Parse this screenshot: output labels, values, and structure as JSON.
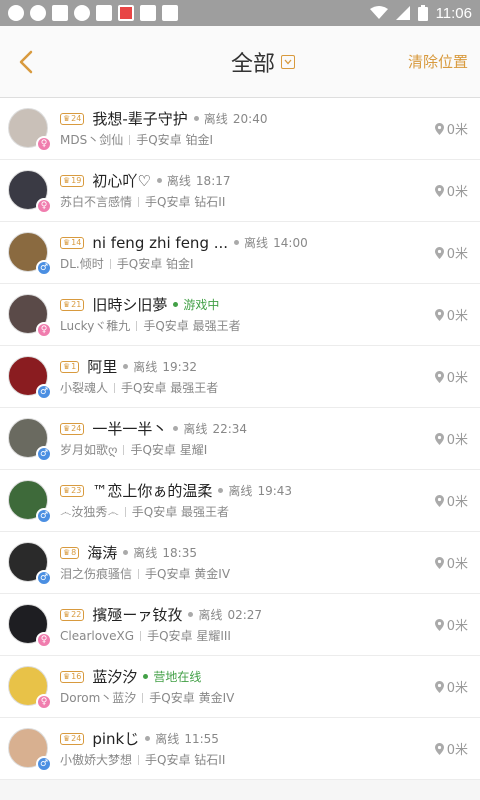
{
  "status_bar": {
    "time": "11:06"
  },
  "header": {
    "title": "全部",
    "clear_label": "清除位置"
  },
  "users": [
    {
      "level": "24",
      "name": "我想-辈子守护",
      "status": "离线",
      "time": "20:40",
      "online": false,
      "nick": "MDS丶剑仙",
      "platform": "手Q安卓",
      "rank": "铂金I",
      "gender": "female",
      "distance": "0米",
      "avatar_color": "#c9c0b8"
    },
    {
      "level": "19",
      "name": "初心吖♡",
      "status": "离线",
      "time": "18:17",
      "online": false,
      "nick": "苏白不言感情",
      "platform": "手Q安卓",
      "rank": "钻石II",
      "gender": "female",
      "distance": "0米",
      "avatar_color": "#3a3a44"
    },
    {
      "level": "14",
      "name": "ni feng zhi feng ...",
      "status": "离线",
      "time": "14:00",
      "online": false,
      "nick": "DL.倾时",
      "platform": "手Q安卓",
      "rank": "铂金I",
      "gender": "male",
      "distance": "0米",
      "avatar_color": "#8a6a40"
    },
    {
      "level": "21",
      "name": "旧時シ旧夢",
      "status": "游戏中",
      "time": "",
      "online": true,
      "nick": "Luckyヾ稚九",
      "platform": "手Q安卓",
      "rank": "最强王者",
      "gender": "female",
      "distance": "0米",
      "avatar_color": "#5a4a48"
    },
    {
      "level": "1",
      "name": "阿里",
      "status": "离线",
      "time": "19:32",
      "online": false,
      "nick": "小裂魂人",
      "platform": "手Q安卓",
      "rank": "最强王者",
      "gender": "male",
      "distance": "0米",
      "avatar_color": "#8a1c20"
    },
    {
      "level": "24",
      "name": "一半一半丶",
      "status": "离线",
      "time": "22:34",
      "online": false,
      "nick": "岁月如歌ღ",
      "platform": "手Q安卓",
      "rank": "星耀I",
      "gender": "male",
      "distance": "0米",
      "avatar_color": "#6a6a60"
    },
    {
      "level": "23",
      "name": "™恋上你ぁ的温柔",
      "status": "离线",
      "time": "19:43",
      "online": false,
      "nick": "෴汝独秀෴",
      "platform": "手Q安卓",
      "rank": "最强王者",
      "gender": "male",
      "distance": "0米",
      "avatar_color": "#3e6a3a"
    },
    {
      "level": "8",
      "name": "海涛",
      "status": "离线",
      "time": "18:35",
      "online": false,
      "nick": "泪之伤痕骚信",
      "platform": "手Q安卓",
      "rank": "黄金IV",
      "gender": "male",
      "distance": "0米",
      "avatar_color": "#2a2a2a"
    },
    {
      "level": "22",
      "name": "擯殛ーァ钕孜",
      "status": "离线",
      "time": "02:27",
      "online": false,
      "nick": "ClearloveXG",
      "platform": "手Q安卓",
      "rank": "星耀III",
      "gender": "female",
      "distance": "0米",
      "avatar_color": "#1e1e22"
    },
    {
      "level": "16",
      "name": "蓝汐汐",
      "status": "营地在线",
      "time": "",
      "online": true,
      "nick": "Dorom丶蓝汐",
      "platform": "手Q安卓",
      "rank": "黄金IV",
      "gender": "female",
      "distance": "0米",
      "avatar_color": "#e8c248"
    },
    {
      "level": "24",
      "name": "pinkじ",
      "status": "离线",
      "time": "11:55",
      "online": false,
      "nick": "小傲娇大梦想",
      "platform": "手Q安卓",
      "rank": "钻石II",
      "gender": "male",
      "distance": "0米",
      "avatar_color": "#d8b090"
    }
  ]
}
